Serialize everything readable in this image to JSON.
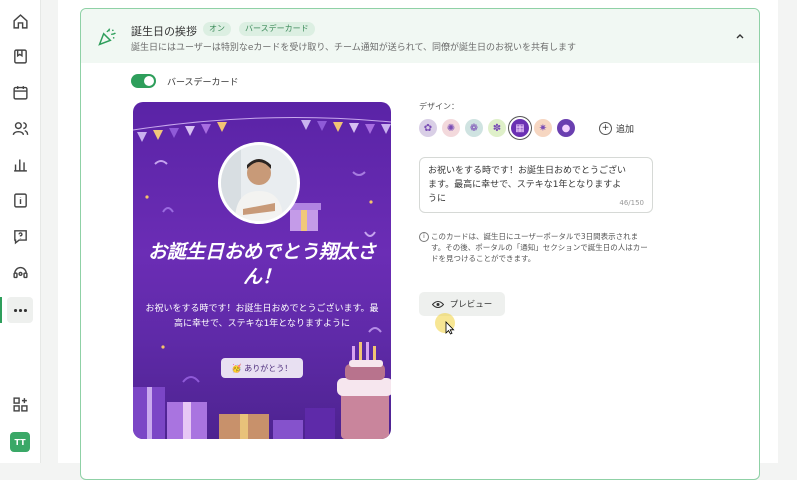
{
  "sidebar": {
    "icons": [
      "home-icon",
      "book-icon",
      "calendar-icon",
      "users-icon",
      "chart-icon",
      "info-card-icon",
      "help-chat-icon",
      "support-icon",
      "more-icon",
      "add-widget-icon"
    ],
    "avatar": "TT"
  },
  "greeting": {
    "title": "誕生日の挨拶",
    "badge_on": "オン",
    "badge_card": "バースデーカード",
    "subtitle": "誕生日にはユーザーは特別なeカードを受け取り、チーム通知が送られて、同僚が誕生日のお祝いを共有します",
    "toggle_label": "バースデーカード"
  },
  "card_preview": {
    "headline": "お誕生日おめでとう翔太さん！",
    "message": "お祝いをする時です！お誕生日おめでとうございます。最高に幸せで、ステキな1年となりますように",
    "thanks_button": "🥳 ありがとう！"
  },
  "design": {
    "label": "デザイン：",
    "swatches": [
      {
        "name": "swatch-flowers-lilac",
        "color": "#d9cfe6",
        "glyph": "✿"
      },
      {
        "name": "swatch-flowers-pink",
        "color": "#f3d9dc",
        "glyph": "✺"
      },
      {
        "name": "swatch-teapot",
        "color": "#cfe3e1",
        "glyph": "❁"
      },
      {
        "name": "swatch-sunflower",
        "color": "#dff0c9",
        "glyph": "✽"
      },
      {
        "name": "swatch-purple-gift",
        "color": "#6a2fb3",
        "glyph": "▦"
      },
      {
        "name": "swatch-orange-star",
        "color": "#f6d6c1",
        "glyph": "✷"
      },
      {
        "name": "swatch-planet",
        "color": "#6a3fb0",
        "glyph": "●"
      }
    ],
    "add_label": "追加",
    "message_text": "お祝いをする時です！お誕生日おめでとうございます。最高に幸せで、ステキな1年となりますように",
    "counter": "46/150",
    "info_text": "このカードは、誕生日にユーザーポータルで3日間表示されます。その後、ポータルの「通知」セクションで誕生日の人はカードを見つけることができます。",
    "preview_button": "プレビュー"
  }
}
